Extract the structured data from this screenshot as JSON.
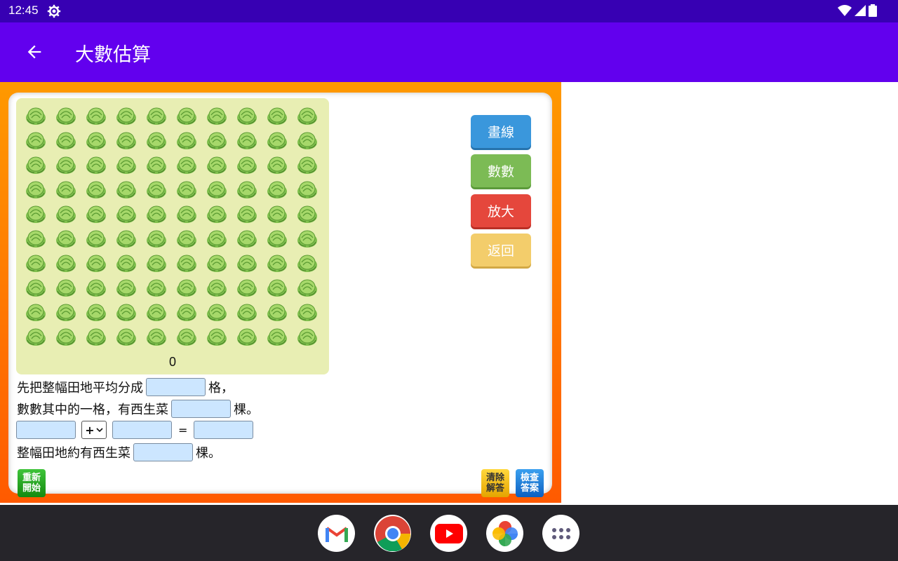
{
  "status_bar": {
    "time": "12:45"
  },
  "app_bar": {
    "title": "大數估算"
  },
  "field": {
    "count": "0",
    "rows": 10,
    "cols": 10
  },
  "side_buttons": {
    "draw": "畫線",
    "count": "數數",
    "zoom": "放大",
    "back": "返回"
  },
  "questions": {
    "line1_prefix": "先把整幅田地平均分成",
    "line1_suffix": "格，",
    "line2_prefix": "數數其中的一格，有西生菜",
    "line2_suffix": "棵。",
    "operator": "+",
    "equals": "=",
    "line4_prefix": "整幅田地約有西生菜",
    "line4_suffix": "棵。"
  },
  "bottom_buttons": {
    "restart": "重新開始",
    "clear": "清除解答",
    "check": "檢查答案"
  },
  "dock": [
    "gmail-icon",
    "chrome-icon",
    "youtube-icon",
    "photos-icon",
    "app-drawer-icon"
  ],
  "colors": {
    "app_bar": "#6200ee",
    "status_bar": "#3700b3",
    "frame": "#ff9900",
    "field": "#e8eeb3"
  }
}
